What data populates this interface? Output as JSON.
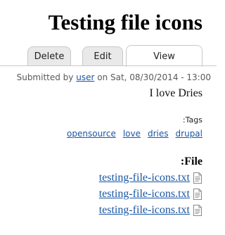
{
  "page": {
    "title": "Testing file icons"
  },
  "tabs": [
    {
      "label": "Delete"
    },
    {
      "label": "Edit"
    },
    {
      "label": "View"
    }
  ],
  "meta": {
    "submitted_prefix": "Submitted by ",
    "author": "user",
    "submitted_suffix": " on Sat, 08/30/2014 - 13:00"
  },
  "content": {
    "body": "I love Dries"
  },
  "tags": {
    "label": "Tags:",
    "items": [
      "opensource",
      "love",
      "dries",
      "drupal"
    ]
  },
  "files": {
    "heading": "File:",
    "items": [
      {
        "name": "testing-file-icons.txt",
        "icon": "text-file-icon"
      },
      {
        "name": "testing-file-icons.txt",
        "icon": "text-file-icon"
      },
      {
        "name": "testing-file-icons.txt",
        "icon": "text-file-icon"
      }
    ]
  }
}
